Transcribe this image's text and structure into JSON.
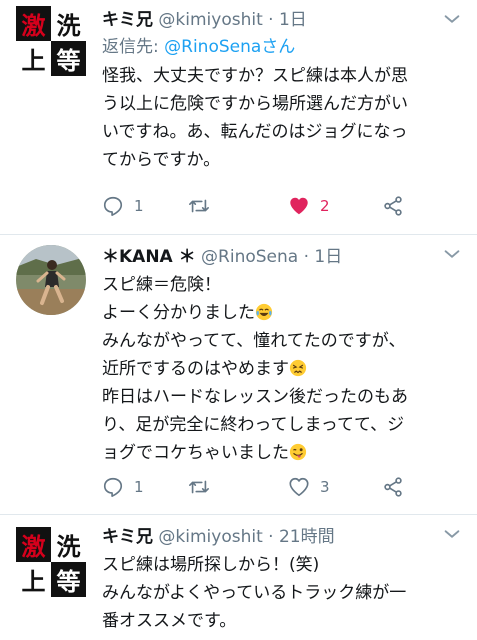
{
  "tweets": [
    {
      "name": "キミ兄",
      "handle": "@kimiyoshit",
      "dot": "·",
      "time": "1日",
      "reply_prefix": "返信先: ",
      "reply_to": "@RinoSenaさん",
      "lines": [
        "怪我、大丈夫ですか？スピ練は本人が思",
        "う以上に危険ですから場所選んだ方がい",
        "いですね。あ、転んだのはジョグになっ",
        "てからですか。"
      ],
      "replies": "1",
      "retweets": "",
      "likes": "2",
      "liked": true,
      "avatar_kanji": [
        "激",
        "洗",
        "上",
        "等"
      ]
    },
    {
      "name": "＊KANA ＊",
      "handle": "@RinoSena",
      "dot": "·",
      "time": "1日",
      "lines": [
        "スピ練＝危険！",
        "よーく分かりました",
        "みんながやってて、憧れてたのですが、",
        "近所でするのはやめます",
        "昨日はハードなレッスン後だったのもあ",
        "り、足が完全に終わってしまってて、ジ",
        "ョグでコケちゃいました"
      ],
      "replies": "1",
      "retweets": "",
      "likes": "3",
      "liked": false
    },
    {
      "name": "キミ兄",
      "handle": "@kimiyoshit",
      "dot": "·",
      "time": "21時間",
      "lines": [
        "スピ練は場所探しから！(笑)",
        "みんながよくやっているトラック練が一",
        "番オススメです。"
      ],
      "avatar_kanji": [
        "激",
        "洗",
        "上",
        "等"
      ]
    }
  ],
  "colors": {
    "link": "#1da1f2",
    "muted": "#657786",
    "like": "#e0245e",
    "divider": "#e1e8ed",
    "avatar_red": "#d6001c"
  },
  "icons": [
    "chevron-down-icon",
    "reply-icon",
    "retweet-icon",
    "heart-icon",
    "share-icon",
    "laughing-tears-emoji",
    "persevering-face-emoji",
    "winking-tongue-emoji"
  ]
}
